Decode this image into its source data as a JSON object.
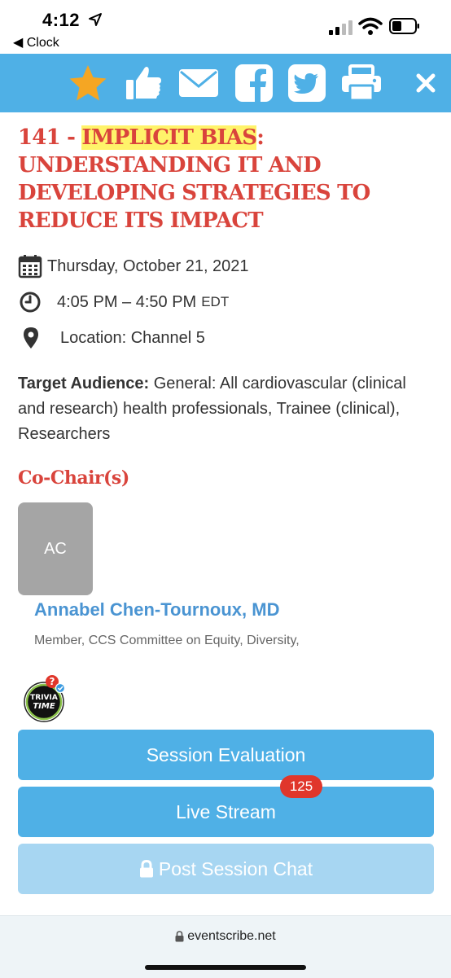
{
  "status_bar": {
    "time": "4:12",
    "back_label": "◀ Clock"
  },
  "toolbar": {
    "icons": [
      "star-icon",
      "thumbs-up-icon",
      "envelope-icon",
      "facebook-icon",
      "twitter-icon",
      "printer-icon",
      "close-icon"
    ],
    "accent_color": "#4fb0e6"
  },
  "session": {
    "title_prefix": "141 - ",
    "title_highlight": "IMPLICIT BIAS",
    "title_rest": ": UNDERSTANDING IT AND DEVELOPING STRATEGIES TO REDUCE ITS IMPACT",
    "date": "Thursday, October 21, 2021",
    "time": "4:05 PM – 4:50 PM",
    "timezone": "EDT",
    "location": "Location: Channel 5",
    "audience_label": "Target Audience:",
    "audience_text": " General: All cardiovascular (clinical and research) health professionals, Trainee (clinical), Researchers",
    "title_color": "#d9443c"
  },
  "cochairs": {
    "heading": "Co-Chair(s)",
    "people": [
      {
        "initials": "AC",
        "name": "Annabel Chen-Tournoux, MD",
        "role": "Member, CCS Committee on Equity, Diversity,"
      }
    ]
  },
  "trivia": {
    "line1": "TRIVIA",
    "line2": "TIME",
    "mark": "?"
  },
  "buttons": {
    "evaluation": "Session Evaluation",
    "live_stream": "Live Stream",
    "live_stream_badge": "125",
    "post_chat": "Post Session Chat"
  },
  "browser": {
    "url": "eventscribe.net"
  }
}
